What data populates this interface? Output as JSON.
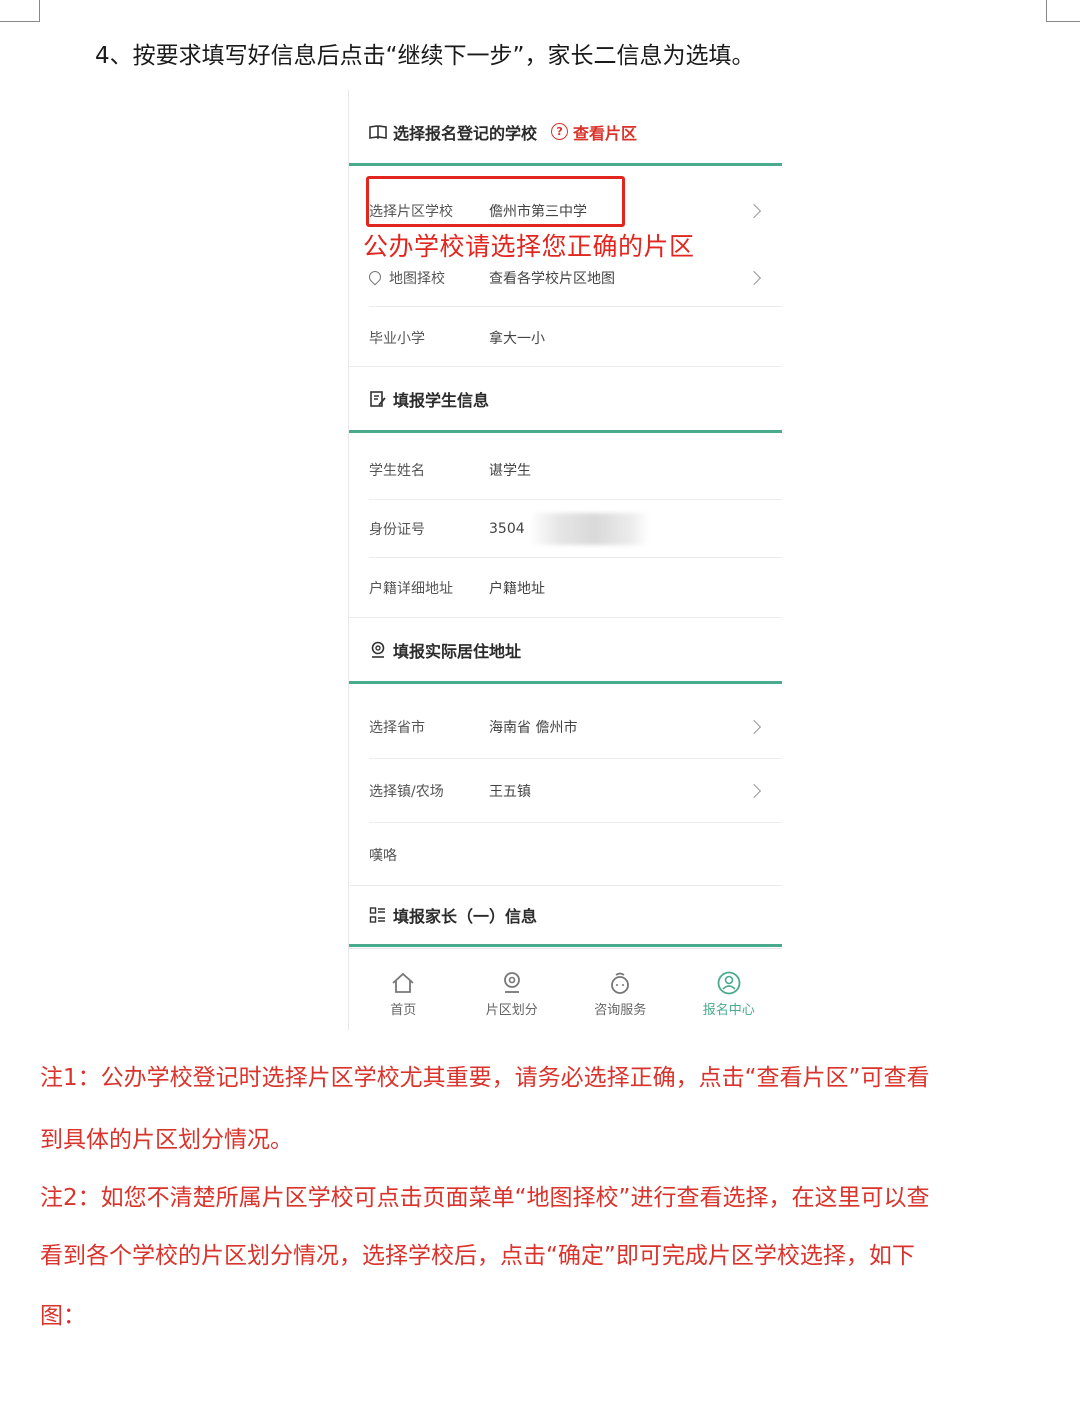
{
  "step_heading": "4、按要求填写好信息后点击“继续下一步”，家长二信息为选填。",
  "phone": {
    "section_school": {
      "title": "选择报名登记的学校",
      "link_text": "查看片区",
      "link_icon": "question-circle-icon"
    },
    "rows_school": [
      {
        "label": "选择片区学校",
        "value": "儋州市第三中学",
        "has_chevron": true
      },
      {
        "label": "地图择校",
        "value": "查看各学校片区地图",
        "has_chevron": true,
        "icon": "map-pin-icon"
      },
      {
        "label": "毕业小学",
        "value": "拿大一小",
        "has_chevron": false
      }
    ],
    "annotation": "公办学校请选择您正确的片区",
    "section_student": {
      "title": "填报学生信息"
    },
    "rows_student": [
      {
        "label": "学生姓名",
        "value": "谌学生"
      },
      {
        "label": "身份证号",
        "value": "3504"
      },
      {
        "label": "户籍详细地址",
        "value": "户籍地址"
      }
    ],
    "section_address": {
      "title": "填报实际居住地址"
    },
    "rows_address": [
      {
        "label": "选择省市",
        "value": "海南省 儋州市",
        "has_chevron": true
      },
      {
        "label": "选择镇/农场",
        "value": "王五镇",
        "has_chevron": true
      },
      {
        "label": "嘆咯",
        "value": ""
      }
    ],
    "section_parent": {
      "title": "填报家长（一）信息"
    },
    "tabs": [
      {
        "label": "首页",
        "icon": "home-icon",
        "active": false
      },
      {
        "label": "片区划分",
        "icon": "location-icon",
        "active": false
      },
      {
        "label": "咨询服务",
        "icon": "chat-icon",
        "active": false
      },
      {
        "label": "报名中心",
        "icon": "user-icon",
        "active": true
      }
    ],
    "accent_color": "#4aab8c",
    "highlight_color": "#e0261f"
  },
  "notes": [
    "注1：公办学校登记时选择片区学校尤其重要，请务必选择正确，点击“查看片区”可查看",
    "到具体的片区划分情况。",
    "注2：如您不清楚所属片区学校可点击页面菜单“地图择校”进行查看选择，在这里可以查",
    "看到各个学校的片区划分情况，选择学校后，点击“确定”即可完成片区学校选择，如下",
    "图："
  ]
}
